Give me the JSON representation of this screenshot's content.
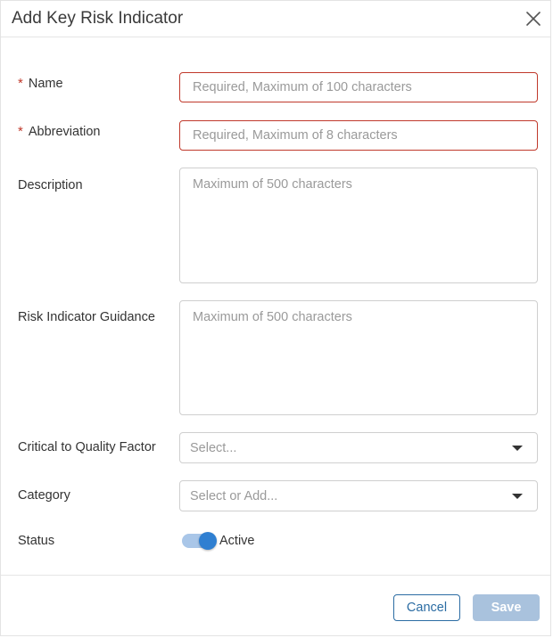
{
  "dialog": {
    "title": "Add Key Risk Indicator"
  },
  "form": {
    "name": {
      "label": "Name",
      "required_mark": "*",
      "value": "",
      "placeholder": "Required, Maximum of 100 characters"
    },
    "abbreviation": {
      "label": "Abbreviation",
      "required_mark": "*",
      "value": "",
      "placeholder": "Required, Maximum of 8 characters"
    },
    "description": {
      "label": "Description",
      "value": "",
      "placeholder": "Maximum of 500 characters"
    },
    "guidance": {
      "label": "Risk Indicator Guidance",
      "value": "",
      "placeholder": "Maximum of 500 characters"
    },
    "ctq_factor": {
      "label": "Critical to Quality Factor",
      "placeholder": "Select..."
    },
    "category": {
      "label": "Category",
      "placeholder": "Select or Add..."
    },
    "status": {
      "label": "Status",
      "toggle_text": "Active",
      "on": true
    }
  },
  "footer": {
    "cancel_label": "Cancel",
    "save_label": "Save"
  },
  "colors": {
    "error_border": "#c0392b",
    "primary": "#2b6ca3",
    "toggle_on": "#2f7fd1",
    "save_disabled": "#a9c2dd"
  },
  "icons": {
    "close": "close-icon",
    "dropdown": "chevron-down-icon"
  }
}
